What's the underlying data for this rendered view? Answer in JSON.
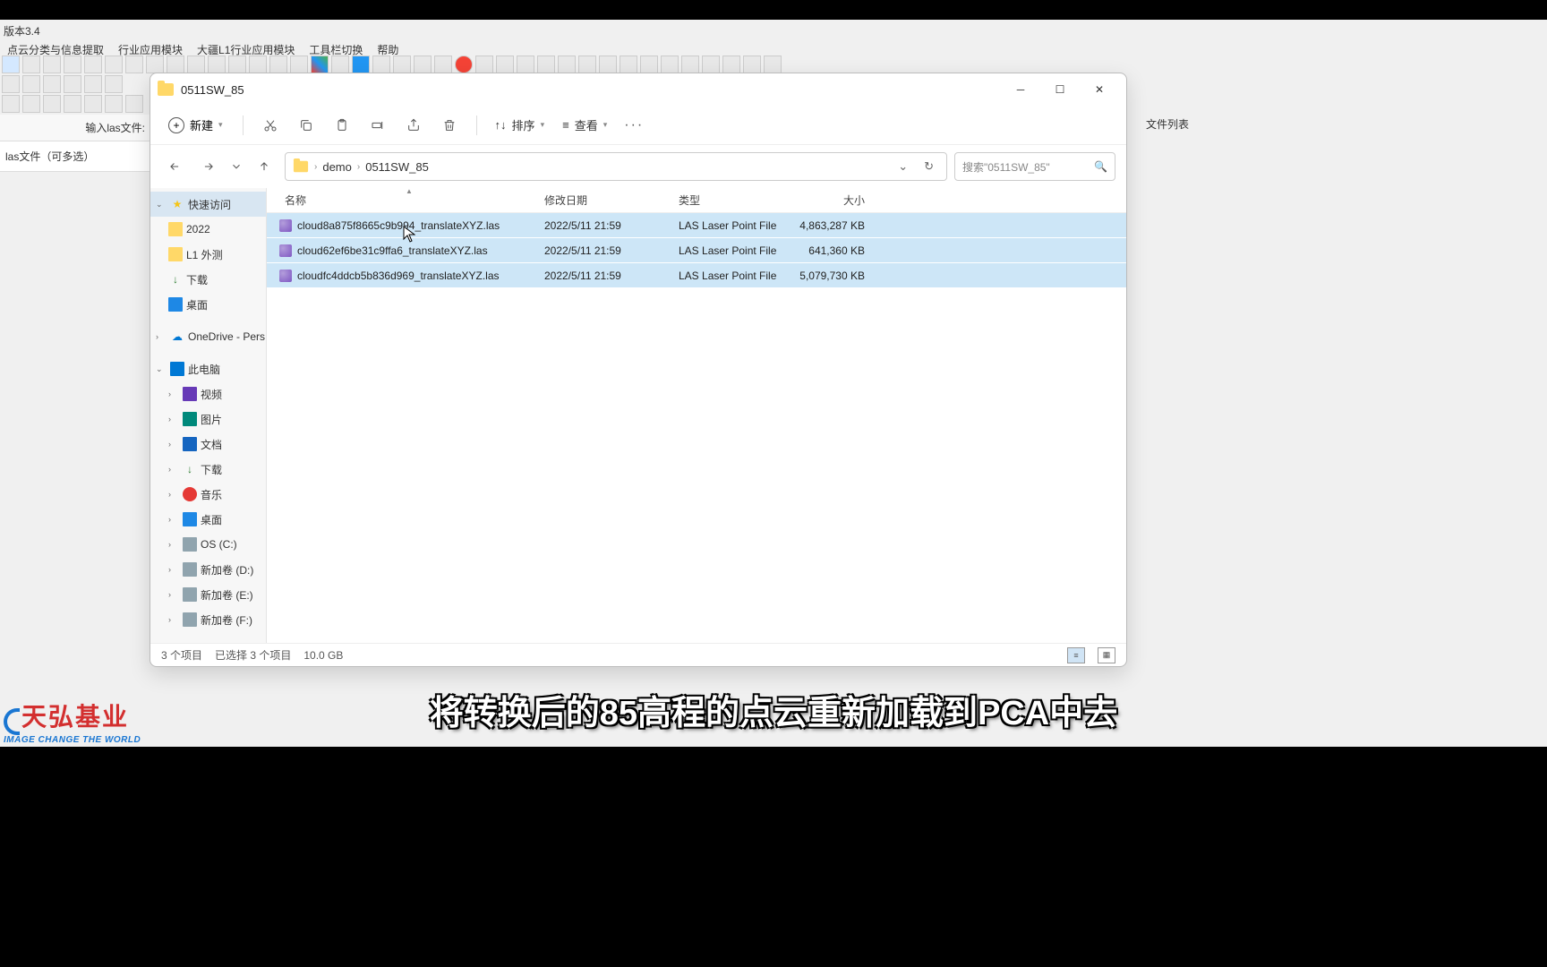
{
  "app": {
    "title": "版本3.4",
    "menus": [
      "点云分类与信息提取",
      "行业应用模块",
      "大疆L1行业应用模块",
      "工具栏切换",
      "帮助"
    ],
    "left_label": "输入las文件:",
    "left_input": "las文件（可多选）",
    "right_label": "文件列表"
  },
  "explorer": {
    "title": "0511SW_85",
    "new_label": "新建",
    "sort_label": "排序",
    "view_label": "查看",
    "breadcrumb": [
      "demo",
      "0511SW_85"
    ],
    "search_placeholder": "搜索\"0511SW_85\"",
    "columns": {
      "name": "名称",
      "date": "修改日期",
      "type": "类型",
      "size": "大小"
    },
    "nav": {
      "quick": "快速访问",
      "y2022": "2022",
      "l1": "L1 外测",
      "downloads": "下载",
      "desktop": "桌面",
      "onedrive": "OneDrive - Pers",
      "thispc": "此电脑",
      "videos": "视频",
      "pictures": "图片",
      "documents": "文档",
      "downloads2": "下载",
      "music": "音乐",
      "desktop2": "桌面",
      "osc": "OS (C:)",
      "drvd": "新加卷 (D:)",
      "drve": "新加卷 (E:)",
      "drvf": "新加卷 (F:)"
    },
    "files": [
      {
        "name": "cloud8a875f8665c9b994_translateXYZ.las",
        "date": "2022/5/11 21:59",
        "type": "LAS Laser Point File",
        "size": "4,863,287 KB"
      },
      {
        "name": "cloud62ef6be31c9ffa6_translateXYZ.las",
        "date": "2022/5/11 21:59",
        "type": "LAS Laser Point File",
        "size": "641,360 KB"
      },
      {
        "name": "cloudfc4ddcb5b836d969_translateXYZ.las",
        "date": "2022/5/11 21:59",
        "type": "LAS Laser Point File",
        "size": "5,079,730 KB"
      }
    ],
    "status": {
      "items": "3 个项目",
      "selected": "已选择 3 个项目",
      "size": "10.0 GB"
    }
  },
  "logo": {
    "main": "天弘基业",
    "sub": "IMAGE CHANGE THE WORLD"
  },
  "subtitle": "将转换后的85高程的点云重新加载到PCA中去"
}
